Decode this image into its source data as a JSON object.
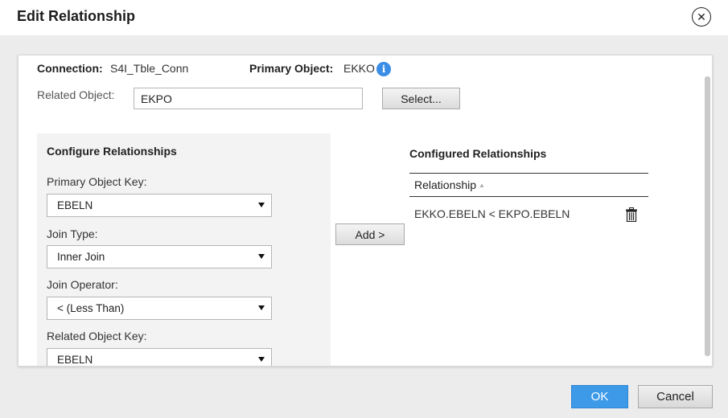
{
  "dialog": {
    "title": "Edit Relationship",
    "close_glyph": "✕"
  },
  "connection": {
    "label": "Connection:",
    "value": "S4I_Tble_Conn"
  },
  "primary_object": {
    "label": "Primary Object:",
    "value": "EKKO",
    "info_glyph": "i"
  },
  "related_object": {
    "label": "Related Object:",
    "value": "EKPO",
    "select_label": "Select..."
  },
  "configure": {
    "heading": "Configure Relationships",
    "primary_key_label": "Primary Object Key:",
    "primary_key_value": "EBELN",
    "join_type_label": "Join Type:",
    "join_type_value": "Inner Join",
    "join_operator_label": "Join Operator:",
    "join_operator_value": "< (Less Than)",
    "related_key_label": "Related Object Key:",
    "related_key_value": "EBELN"
  },
  "add_button": "Add >",
  "configured": {
    "heading": "Configured Relationships",
    "column_header": "Relationship",
    "sort_glyph": "▲",
    "rows": [
      {
        "relationship": "EKKO.EBELN < EKPO.EBELN"
      }
    ]
  },
  "footer": {
    "ok_label": "OK",
    "cancel_label": "Cancel"
  },
  "colors": {
    "ok_button": "#3d9ae8",
    "info_icon": "#3a8ee6",
    "panel_bg": "#f3f3f3"
  },
  "icons": {
    "close": "close-icon",
    "info": "info-icon",
    "caret": "chevron-down-icon",
    "delete": "trash-icon",
    "sort": "sort-ascending-icon"
  }
}
